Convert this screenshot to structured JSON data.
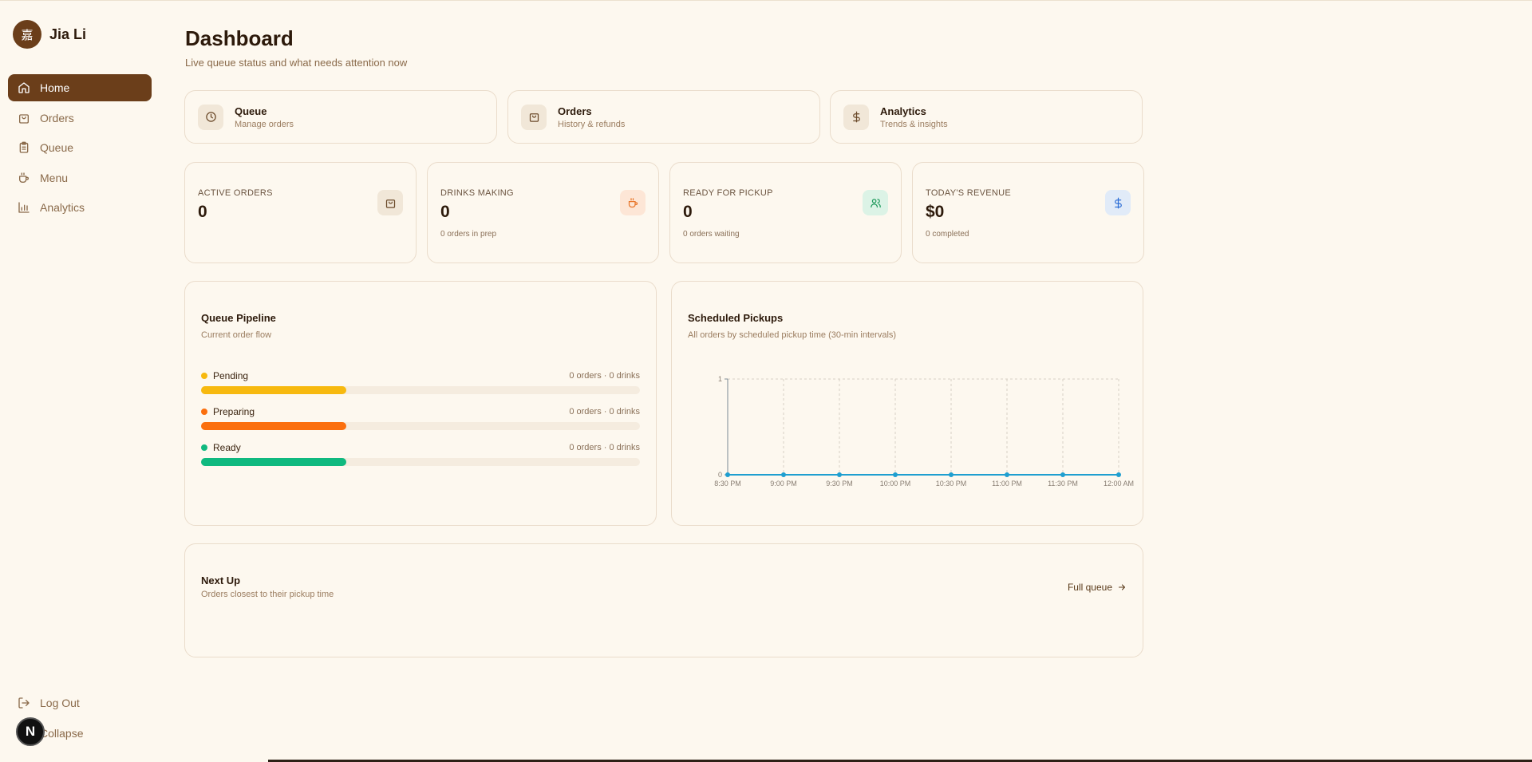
{
  "user": {
    "avatar_char": "嘉",
    "name": "Jia Li"
  },
  "nav": [
    {
      "label": "Home",
      "icon": "home-icon",
      "active": true
    },
    {
      "label": "Orders",
      "icon": "bag-icon"
    },
    {
      "label": "Queue",
      "icon": "clipboard-icon"
    },
    {
      "label": "Menu",
      "icon": "coffee-icon"
    },
    {
      "label": "Analytics",
      "icon": "bar-chart-icon"
    }
  ],
  "bottom_nav": {
    "logout": "Log Out",
    "collapse": "Collapse"
  },
  "dev_badge": "N",
  "header": {
    "title": "Dashboard",
    "subtitle": "Live queue status and what needs attention now"
  },
  "quick_links": [
    {
      "title": "Queue",
      "sub": "Manage orders",
      "icon": "clock-icon"
    },
    {
      "title": "Orders",
      "sub": "History & refunds",
      "icon": "bag-icon"
    },
    {
      "title": "Analytics",
      "sub": "Trends & insights",
      "icon": "dollar-icon"
    }
  ],
  "stats": [
    {
      "label": "ACTIVE ORDERS",
      "value": "0",
      "sub": "",
      "icon": "bag-icon",
      "icon_bg": "#f1e7d8",
      "icon_color": "#6b4a2a"
    },
    {
      "label": "DRINKS MAKING",
      "value": "0",
      "sub": "0 orders in prep",
      "icon": "coffee-icon",
      "icon_bg": "#fde6d6",
      "icon_color": "#e8762b"
    },
    {
      "label": "READY FOR PICKUP",
      "value": "0",
      "sub": "0 orders waiting",
      "icon": "users-icon",
      "icon_bg": "#dcf3e6",
      "icon_color": "#1f9a5c"
    },
    {
      "label": "TODAY'S REVENUE",
      "value": "$0",
      "sub": "0 completed",
      "icon": "dollar-icon",
      "icon_bg": "#e1ebf8",
      "icon_color": "#2f6fd6"
    }
  ],
  "pipeline": {
    "title": "Queue Pipeline",
    "subtitle": "Current order flow",
    "rows": [
      {
        "name": "Pending",
        "count": "0 orders · 0 drinks",
        "color": "#f7b90f",
        "fill": 0.33
      },
      {
        "name": "Preparing",
        "count": "0 orders · 0 drinks",
        "color": "#fb6f0e",
        "fill": 0.33
      },
      {
        "name": "Ready",
        "count": "0 orders · 0 drinks",
        "color": "#10b97f",
        "fill": 0.33
      }
    ]
  },
  "pickups": {
    "title": "Scheduled Pickups",
    "subtitle": "All orders by scheduled pickup time (30-min intervals)"
  },
  "chart_data": {
    "type": "line",
    "x": [
      "8:30 PM",
      "9:00 PM",
      "9:30 PM",
      "10:00 PM",
      "10:30 PM",
      "11:00 PM",
      "11:30 PM",
      "12:00 AM"
    ],
    "series": [
      {
        "values": [
          0,
          0,
          0,
          0,
          0,
          0,
          0,
          0
        ]
      }
    ],
    "ylim": [
      0,
      1
    ],
    "yticks": [
      "0",
      "1"
    ],
    "grid": true,
    "color": "#1f9fd0"
  },
  "next_up": {
    "title": "Next Up",
    "subtitle": "Orders closest to their pickup time",
    "link": "Full queue"
  }
}
